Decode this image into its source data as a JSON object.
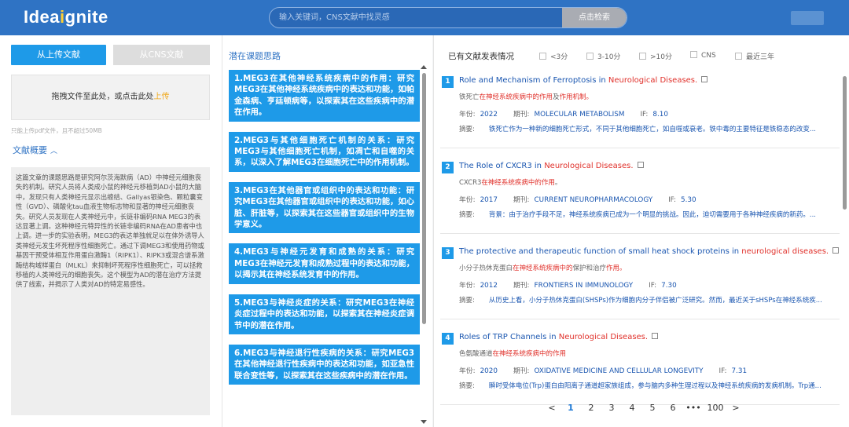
{
  "header": {
    "logo_a": "Idea",
    "logo_dot": "i",
    "logo_b": "gnite",
    "search_placeholder": "输入关键词，CNS文献中找灵感",
    "search_button": "点击检索"
  },
  "left": {
    "tab_upload": "从上传文献",
    "tab_cns": "从CNS文献",
    "dropzone_text": "拖拽文件至此处，或点击此处",
    "dropzone_link": "上传",
    "hint": "只能上传pdf文件，且不超过50MB",
    "abstract_title": "文献概要",
    "abstract_text": "这篇文章的课题思路是研究阿尔茨海默病（AD）中神经元细胞丧失的机制。研究人员将人类成小鼠的神经元移植到AD小鼠的大脑中，发现只有人类神经元显示出缠结、Gallyas银染色、颗粒囊变性（GVD）、磷酸化tau血液生物标志物和显著的神经元细胞丧失。研究人员发现在人类神经元中，长链非编码RNA MEG3的表达显著上调。这种神经元特异性的长链非编码RNA在AD患者中也上调。进一步的实验表明，MEG3的表达单独就足以在体外诱导人类神经元发生坏死程序性细胞死亡。通过下调MEG3和使用药物或基因干预受体相互作用蛋白激酶1（RIPK1）、RIPK3或混合谱系激酶结构域样蛋白（MLKL）来抑制坏死程序性细胞死亡，可以拯救移植的人类神经元的细胞丧失。这个模型为AD的潜在治疗方法提供了线索，并揭示了人类对AD的特定易感性。"
  },
  "middle": {
    "title": "潜在课题思路",
    "ideas": [
      "1.MEG3在其他神经系统疾病中的作用：研究MEG3在其他神经系统疾病中的表达和功能，如帕金森病、亨廷顿病等，以探索其在这些疾病中的潜在作用。",
      "2.MEG3与其他细胞死亡机制的关系：研究MEG3与其他细胞死亡机制，如凋亡和自噬的关系，以深入了解MEG3在细胞死亡中的作用机制。",
      "3.MEG3在其他器官或组织中的表达和功能：研究MEG3在其他器官或组织中的表达和功能，如心脏、肝脏等，以探索其在这些器官或组织中的生物学意义。",
      "4.MEG3与神经元发育和成熟的关系：研究MEG3在神经元发育和成熟过程中的表达和功能，以揭示其在神经系统发育中的作用。",
      "5.MEG3与神经炎症的关系：研究MEG3在神经炎症过程中的表达和功能，以探索其在神经炎症调节中的潜在作用。",
      "6.MEG3与神经退行性疾病的关系：研究MEG3在其他神经退行性疾病中的表达和功能，如亚急性联合变性等，以探索其在这些疾病中的潜在作用。"
    ]
  },
  "right": {
    "filter_label": "已有文献发表情况",
    "filters": [
      "<3分",
      "3-10分",
      ">10分",
      "CNS",
      "最近三年"
    ],
    "labels": {
      "year": "年份:",
      "journal": "期刊:",
      "if": "IF:",
      "abstract": "摘要:"
    },
    "papers": [
      {
        "num": "1",
        "title_a": "Role and Mechanism of Ferroptosis in ",
        "title_b": "Neurological Diseases.",
        "title_c": "",
        "sub_a": "铁死亡",
        "sub_b": "在神经系统疾病中的作用",
        "sub_c": "及",
        "sub_d": "作用机制。",
        "year": "2022",
        "journal": "MOLECULAR METABOLISM",
        "if": "8.10",
        "abstract": "铁死亡作为一种新的细胞死亡形式，不同于其他细胞死亡，如自噬或衰老。铁中毒的主要特征是铁稳态的改变..."
      },
      {
        "num": "2",
        "title_a": "The Role of CXCR3 in ",
        "title_b": "Neurological Diseases.",
        "title_c": "",
        "sub_a": "CXCR3",
        "sub_b": "在神经系统疾病中的作用",
        "sub_c": "。",
        "sub_d": "",
        "year": "2017",
        "journal": "CURRENT NEUROPHARMACOLOGY",
        "if": "5.30",
        "abstract": "背景：由于治疗手段不足，神经系统疾病已成为一个明显的挑战。因此，迫切需要用于各种神经疾病的新药。..."
      },
      {
        "num": "3",
        "title_a": "The protective and therapeutic function of small heat shock proteins in ",
        "title_b": "neurological diseases.",
        "title_c": "",
        "sub_a": "小分子热休克蛋白",
        "sub_b": "在神经系统疾病中的",
        "sub_c": "保护和治疗",
        "sub_d": "作用。",
        "year": "2012",
        "journal": "FRONTIERS IN IMMUNOLOGY",
        "if": "7.30",
        "abstract": "从历史上看，小分子热休克蛋白(SHSPs)作为细胞内分子伴侣被广泛研究。然而，最近关于sHSPs在神经系统疾..."
      },
      {
        "num": "4",
        "title_a": "Roles of TRP Channels in ",
        "title_b": "Neurological Diseases.",
        "title_c": "",
        "sub_a": "色氨酸通道",
        "sub_b": "在神经系统疾病中的作用",
        "sub_c": "",
        "sub_d": "",
        "year": "2020",
        "journal": "OXIDATIVE MEDICINE AND CELLULAR LONGEVITY",
        "if": "7.31",
        "abstract": "瞬时受体电位(Trp)蛋白由阳离子通道超家族组成，参与脑内多种生理过程以及神经系统疾病的发病机制。Trp通..."
      }
    ],
    "pagination": [
      "<",
      "1",
      "2",
      "3",
      "4",
      "5",
      "6",
      "•••",
      "100",
      ">"
    ],
    "current_page": "1"
  }
}
